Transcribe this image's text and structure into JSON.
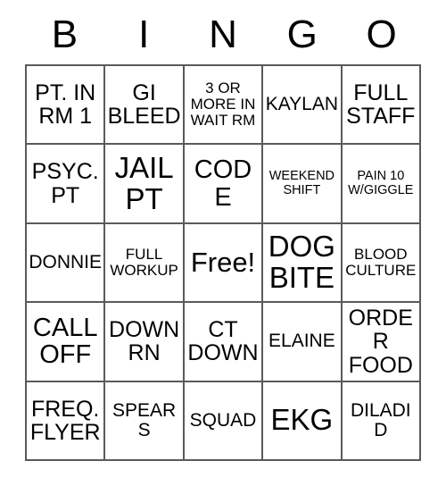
{
  "card": {
    "title": "BINGO",
    "header_letters": [
      "B",
      "I",
      "N",
      "G",
      "O"
    ],
    "columns": 5,
    "rows": 5,
    "colors": {
      "background": "#ffffff",
      "text": "#000000",
      "grid_line": "#5a5a5a"
    },
    "squares": [
      {
        "text": "PT. IN RM 1",
        "size": "fs-l",
        "name": "square-pt-in-rm-1"
      },
      {
        "text": "GI BLEED",
        "size": "fs-l",
        "name": "square-gi-bleed"
      },
      {
        "text": "3 OR MORE IN WAIT RM",
        "size": "fs-s",
        "name": "square-3-or-more-in-wait-rm"
      },
      {
        "text": "KAYLAN",
        "size": "fs-m",
        "name": "square-kaylan"
      },
      {
        "text": "FULL STAFF",
        "size": "fs-l",
        "name": "square-full-staff"
      },
      {
        "text": "PSYC. PT",
        "size": "fs-l",
        "name": "square-psyc-pt"
      },
      {
        "text": "JAIL PT",
        "size": "fs-xxl",
        "name": "square-jail-pt"
      },
      {
        "text": "CODE",
        "size": "fs-xl",
        "name": "square-code"
      },
      {
        "text": "WEEKEND SHIFT",
        "size": "fs-xs",
        "name": "square-weekend-shift"
      },
      {
        "text": "PAIN 10 W/GIGGLE",
        "size": "fs-xs",
        "name": "square-pain-10-w-giggle"
      },
      {
        "text": "DONNIE",
        "size": "fs-m",
        "name": "square-donnie"
      },
      {
        "text": "FULL WORKUP",
        "size": "fs-s",
        "name": "square-full-workup"
      },
      {
        "text": "Free!",
        "size": "free",
        "name": "square-free-space"
      },
      {
        "text": "DOG BITE",
        "size": "fs-xxl",
        "name": "square-dog-bite"
      },
      {
        "text": "BLOOD CULTURE",
        "size": "fs-s",
        "name": "square-blood-culture"
      },
      {
        "text": "CALL OFF",
        "size": "fs-xl",
        "name": "square-call-off"
      },
      {
        "text": "DOWN RN",
        "size": "fs-l",
        "name": "square-down-rn"
      },
      {
        "text": "CT DOWN",
        "size": "fs-l",
        "name": "square-ct-down"
      },
      {
        "text": "ELAINE",
        "size": "fs-m",
        "name": "square-elaine"
      },
      {
        "text": "ORDER FOOD",
        "size": "fs-l",
        "name": "square-order-food"
      },
      {
        "text": "FREQ. FLYER",
        "size": "fs-l",
        "name": "square-freq-flyer"
      },
      {
        "text": "SPEARS",
        "size": "fs-m",
        "name": "square-spears"
      },
      {
        "text": "SQUAD",
        "size": "fs-m",
        "name": "square-squad"
      },
      {
        "text": "EKG",
        "size": "fs-xxl",
        "name": "square-ekg"
      },
      {
        "text": "DILADID",
        "size": "fs-m",
        "name": "square-diladid"
      }
    ]
  }
}
